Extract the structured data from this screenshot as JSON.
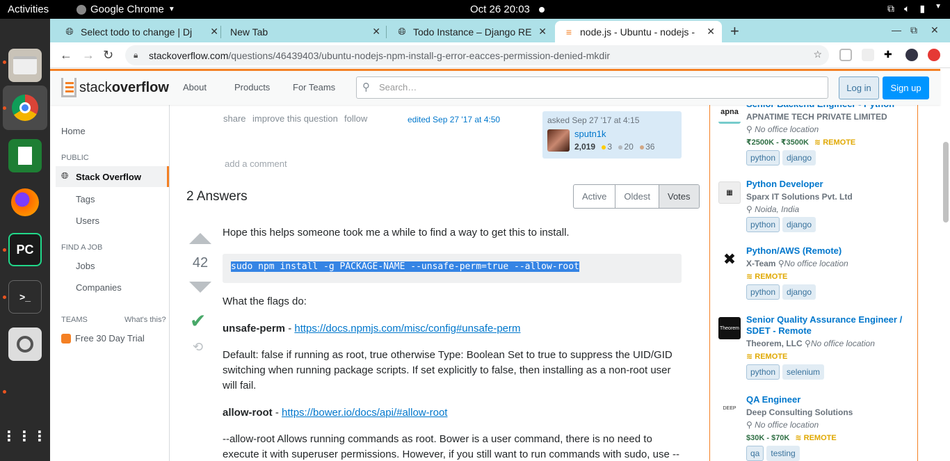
{
  "topbar": {
    "activities": "Activities",
    "app_name": "Google Chrome",
    "clock": "Oct 26  20:03"
  },
  "browser": {
    "tabs": [
      {
        "title": "Select todo to change | Dj"
      },
      {
        "title": "New Tab"
      },
      {
        "title": "Todo Instance – Django RE"
      },
      {
        "title": "node.js - Ubuntu - nodejs -"
      }
    ],
    "url_host": "stackoverflow.com",
    "url_path": "/questions/46439403/ubuntu-nodejs-npm-install-g-error-eacces-permission-denied-mkdir"
  },
  "so_header": {
    "logo_regular": "stack",
    "logo_bold": "overflow",
    "nav": [
      "About",
      "Products",
      "For Teams"
    ],
    "search_placeholder": "Search…",
    "login": "Log in",
    "signup": "Sign up"
  },
  "leftnav": {
    "home": "Home",
    "public_head": "PUBLIC",
    "stack_overflow": "Stack Overflow",
    "tags": "Tags",
    "users": "Users",
    "find_job_head": "FIND A JOB",
    "jobs": "Jobs",
    "companies": "Companies",
    "teams_head": "TEAMS",
    "whats_this": "What's this?",
    "free_trial": "Free 30 Day Trial"
  },
  "question_footer": {
    "share": "share",
    "improve": "improve this question",
    "follow": "follow",
    "edited": "edited Sep 27 '17 at 4:50",
    "asked": "asked Sep 27 '17 at 4:15",
    "user": "sputn1k",
    "reputation": "2,019",
    "gold": "3",
    "silver": "20",
    "bronze": "36",
    "add_comment": "add a comment"
  },
  "answers": {
    "heading": "2 Answers",
    "sort_tabs": [
      "Active",
      "Oldest",
      "Votes"
    ],
    "votes": "42",
    "intro": "Hope this helps someone took me a while to find a way to get this to install.",
    "code": "sudo npm install -g PACKAGE-NAME --unsafe-perm=true --allow-root",
    "flags_intro": "What the flags do:",
    "flag1_name": "unsafe-perm",
    "flag1_sep": " - ",
    "flag1_link": "https://docs.npmjs.com/misc/config#unsafe-perm",
    "flag1_desc": "Default: false if running as root, true otherwise Type: Boolean Set to true to suppress the UID/GID switching when running package scripts. If set explicitly to false, then installing as a non-root user will fail.",
    "flag2_name": "allow-root",
    "flag2_sep": " - ",
    "flag2_link": "https://bower.io/docs/api/#allow-root",
    "flag2_desc": "--allow-root Allows running commands as root. Bower is a user command, there is no need to execute it with superuser permissions. However, if you still want to run commands with sudo, use --"
  },
  "jobs": [
    {
      "title": "Senior Backend Engineer - Python",
      "company": "APNATIME TECH PRIVATE LIMITED",
      "location": "No office location",
      "salary": "₹2500K - ₹3500K",
      "remote": "REMOTE",
      "tags": [
        "python",
        "django"
      ],
      "logo": "apna"
    },
    {
      "title": "Python Developer",
      "company": "Sparx IT Solutions Pvt. Ltd",
      "location": "Noida, India",
      "tags": [
        "python",
        "django"
      ]
    },
    {
      "title": "Python/AWS (Remote)",
      "company": "X-Team",
      "location": "No office location",
      "remote": "REMOTE",
      "tags": [
        "python",
        "django"
      ],
      "logo": "✖"
    },
    {
      "title": "Senior Quality Assurance Engineer / SDET - Remote",
      "company": "Theorem, LLC",
      "location": "No office location",
      "remote": "REMOTE",
      "tags": [
        "python",
        "selenium"
      ],
      "logo": "Theorem"
    },
    {
      "title": "QA Engineer",
      "company": "Deep Consulting Solutions",
      "location": "No office location",
      "salary": "$30K - $70K",
      "remote": "REMOTE",
      "tags": [
        "qa",
        "testing"
      ],
      "logo": "DEEP"
    }
  ],
  "colors": {
    "so_orange": "#f48024",
    "link_blue": "#0077cc",
    "accept_green": "#48a868",
    "tab_bar": "#aee1e8"
  }
}
